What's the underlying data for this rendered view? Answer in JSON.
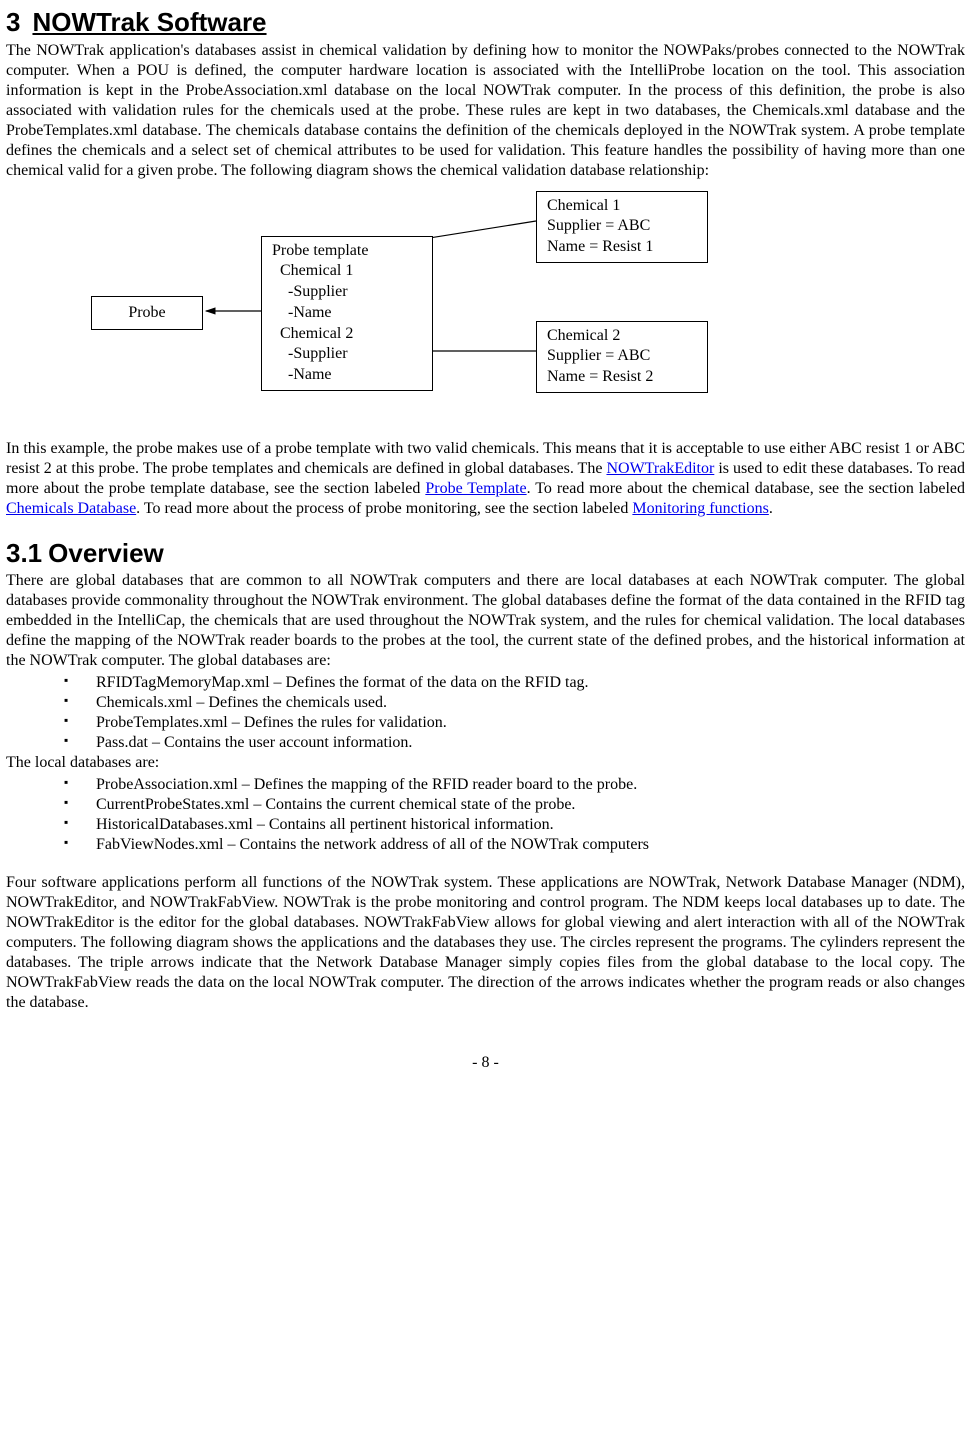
{
  "section3": {
    "number": "3",
    "title": "NOWTrak Software",
    "para1a": "The NOWTrak application's databases assist in chemical validation by defining how to monitor the NOWPaks/probes connected to the NOWTrak computer.  When a POU is defined, the computer hardware location is associated with the IntelliProbe location on the tool.  This association information is kept in the ProbeAssociation.xml database on the local NOWTrak computer.  In the process of this definition, the probe is also associated with validation rules for the chemicals used at the probe. These rules are kept in two databases, the Chemicals.xml database and the ProbeTemplates.xml database. The chemicals database contains the definition of the chemicals deployed in the NOWTrak system.  A probe template defines the chemicals and a select set of chemical attributes to be used for validation. This feature handles the possibility of having more than one chemical valid for a given probe. The following diagram shows the chemical validation database relationship:"
  },
  "diagram": {
    "probe": "Probe",
    "template": {
      "l1": "Probe template",
      "l2": "  Chemical 1",
      "l3": "    -Supplier",
      "l4": "    -Name",
      "l5": "  Chemical 2",
      "l6": "    -Supplier",
      "l7": "    -Name"
    },
    "chem1": {
      "l1": "Chemical 1",
      "l2": "Supplier = ABC",
      "l3": "Name = Resist 1"
    },
    "chem2": {
      "l1": "Chemical 2",
      "l2": "Supplier = ABC",
      "l3": "Name = Resist 2"
    }
  },
  "para2": {
    "t1": "In this example, the probe makes use of a probe template with two valid chemicals.  This means that it is acceptable to use either ABC resist 1 or ABC resist 2 at this probe. The probe templates and chemicals are defined in global databases.  The ",
    "link1": "NOWTrakEditor",
    "t2": " is used to edit these databases.  To read more about the probe template database, see the section labeled ",
    "link2": "Probe Template",
    "t3": ". To read more about the chemical database, see the section labeled ",
    "link3": "Chemicals Database",
    "t4": ".  To read more about the process of probe monitoring, see the section labeled ",
    "link4": "Monitoring functions",
    "t5": "."
  },
  "section31": {
    "number": "3.1",
    "title": "Overview",
    "para1": "There are global databases that are common to all NOWTrak computers and there are local databases at each NOWTrak computer.  The global databases provide commonality throughout the NOWTrak environment.  The global databases define the format of the data contained in the RFID tag embedded in the IntelliCap, the chemicals that are used throughout the NOWTrak system, and the rules for chemical validation.  The local databases define the mapping of the NOWTrak reader boards to the probes at the tool, the current state of the defined probes, and the historical information at the NOWTrak computer.  The global databases are:",
    "globalList": [
      "RFIDTagMemoryMap.xml – Defines the format of the data on the RFID tag.",
      "Chemicals.xml – Defines the chemicals used.",
      "ProbeTemplates.xml – Defines the rules for validation.",
      "Pass.dat – Contains the user account information."
    ],
    "localIntro": "The local databases are:",
    "localList": [
      "ProbeAssociation.xml – Defines the mapping of the RFID reader board to the probe.",
      "CurrentProbeStates.xml – Contains the current chemical state of the probe.",
      "HistoricalDatabases.xml – Contains all pertinent historical information.",
      "FabViewNodes.xml – Contains the network address of all of the NOWTrak computers"
    ],
    "para2": "Four software applications perform all functions of the NOWTrak system.  These applications are NOWTrak, Network Database Manager (NDM), NOWTrakEditor, and NOWTrakFabView.  NOWTrak is the probe monitoring and control program.  The NDM keeps local databases up to date. The NOWTrakEditor is the editor for the global databases.  NOWTrakFabView allows for global viewing and alert interaction with all of the NOWTrak computers.  The following diagram shows the applications and the databases they use. The circles represent the programs.  The cylinders represent the databases. The triple arrows indicate that the Network Database Manager simply copies files from the global database to the local copy.  The NOWTrakFabView reads the data on the local NOWTrak computer. The direction of the arrows indicates whether the program reads or also changes the database."
  },
  "page": "- 8 -"
}
